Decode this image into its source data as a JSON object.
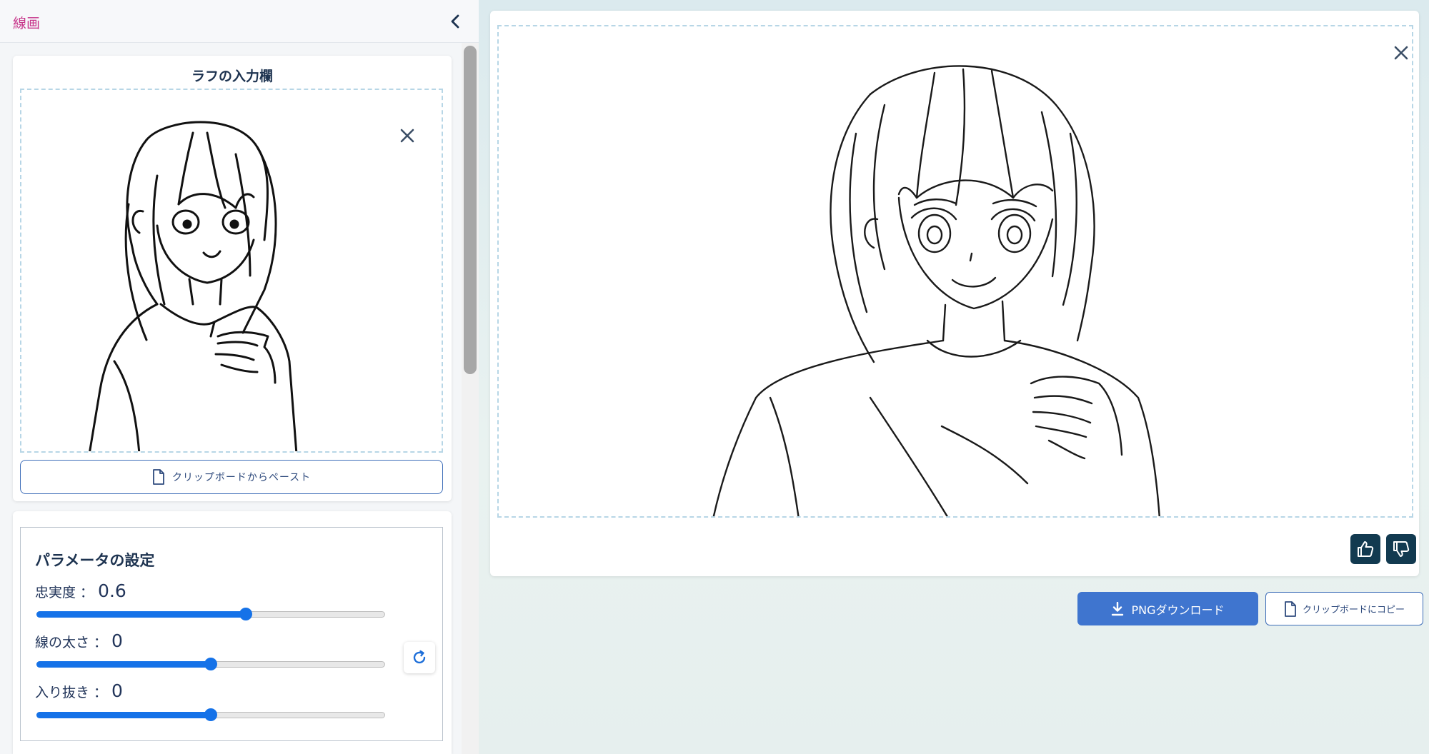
{
  "sidebar": {
    "title": "線画",
    "collapse_icon": "chevron-left-icon"
  },
  "rough_input": {
    "title": "ラフの入力欄",
    "clear_icon": "close-icon",
    "image_description": "rough sketch of a girl",
    "paste_label": "クリップボードからペースト",
    "paste_icon": "document-icon"
  },
  "parameters": {
    "title": "パラメータの設定",
    "items": [
      {
        "label": "忠実度 ：",
        "value": "0.6",
        "fraction": 0.6
      },
      {
        "label": "線の太さ ：",
        "value": "0",
        "fraction": 0.5
      },
      {
        "label": "入り抜き ：",
        "value": "0",
        "fraction": 0.5
      }
    ],
    "reset_icon": "refresh-icon"
  },
  "result": {
    "clear_icon": "close-icon",
    "image_description": "clean line art of a girl",
    "thumbs_up_icon": "thumbs-up-icon",
    "thumbs_down_icon": "thumbs-down-icon",
    "download_label": "PNGダウンロード",
    "download_icon": "download-icon",
    "copy_label": "クリップボードにコピー",
    "copy_icon": "document-icon"
  },
  "colors": {
    "accent_pink": "#c7358a",
    "primary_blue": "#3f75cf",
    "slider_blue": "#1572e8",
    "feedback_button": "#123a50"
  }
}
